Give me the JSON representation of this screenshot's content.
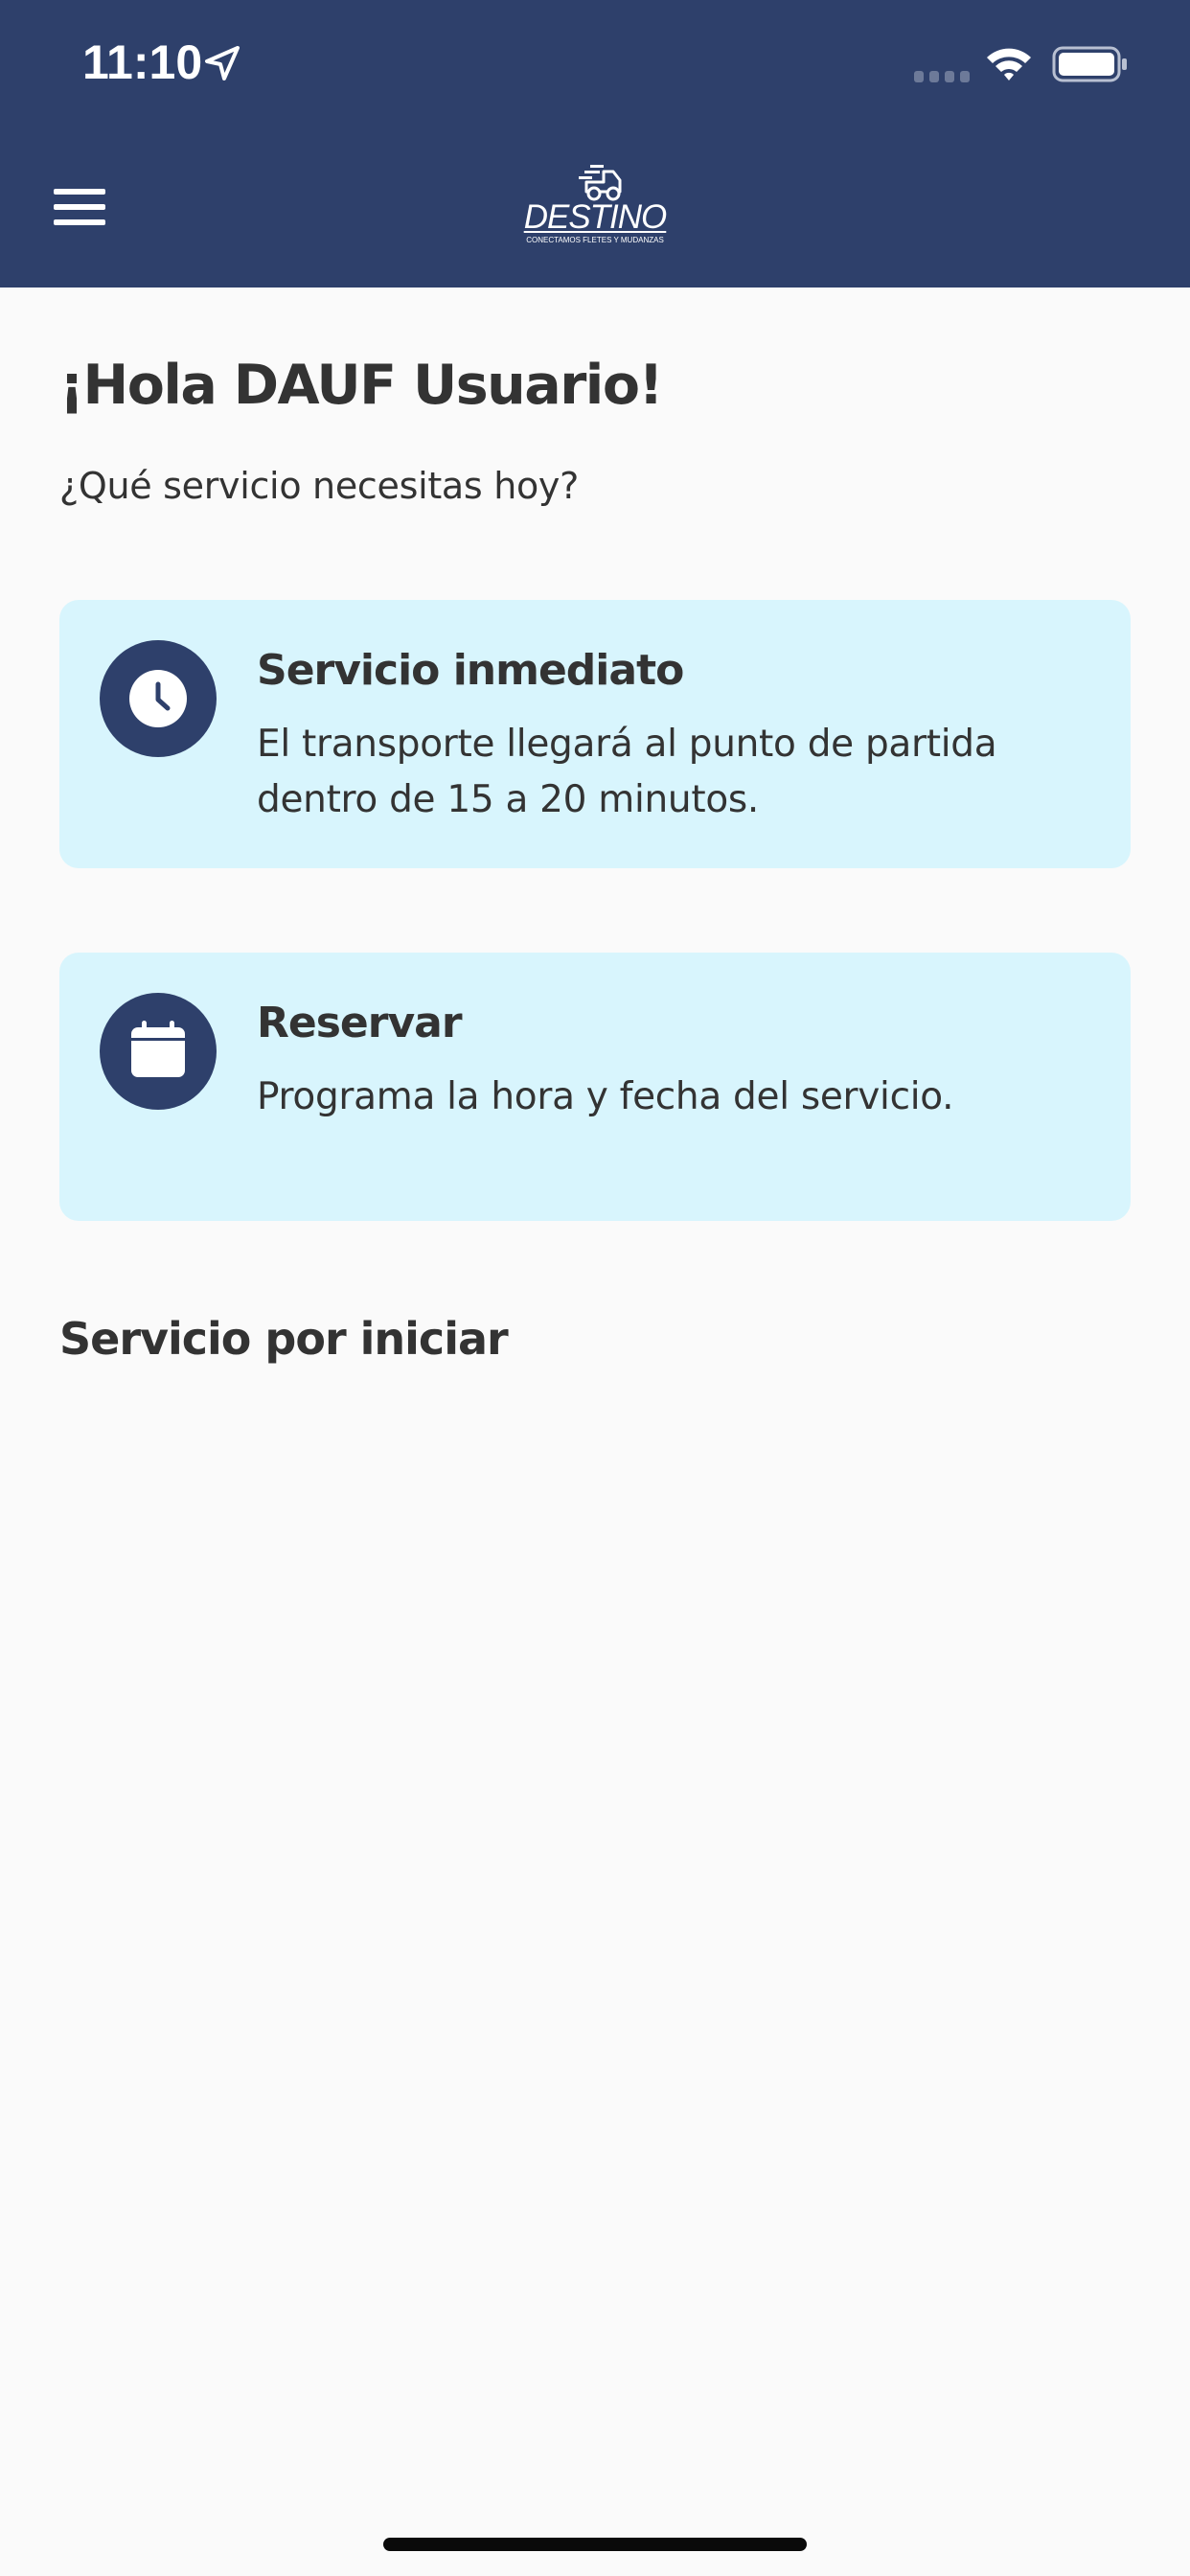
{
  "status_bar": {
    "time": "11:10",
    "icons": [
      "location-arrow-icon",
      "cellular-signal-icon",
      "wifi-icon",
      "battery-icon"
    ]
  },
  "header": {
    "menu_icon": "hamburger-menu-icon",
    "logo": {
      "name": "DESTINO",
      "tagline": "CONECTAMOS FLETES Y MUDANZAS"
    }
  },
  "main": {
    "greeting": "¡Hola DAUF Usuario!",
    "prompt": "¿Qué servicio necesitas hoy?",
    "options": [
      {
        "icon": "clock-icon",
        "title": "Servicio inmediato",
        "description": "El transporte llegará al punto de partida dentro de 15 a 20 minutos."
      },
      {
        "icon": "calendar-icon",
        "title": "Reservar",
        "description": "Programa la hora y fecha del servicio."
      }
    ],
    "pending_section_title": "Servicio por iniciar"
  },
  "colors": {
    "primary": "#2e406b",
    "card_background": "#d8f5fd",
    "page_background": "#fafafa",
    "text": "#333333"
  }
}
